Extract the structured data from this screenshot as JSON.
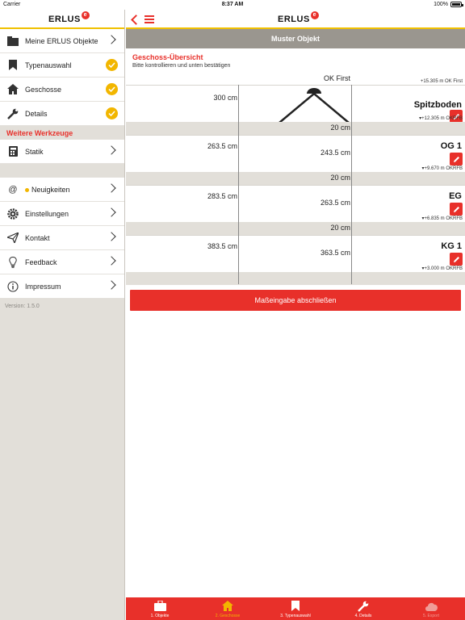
{
  "status_bar": {
    "carrier": "Carrier",
    "time": "8:37 AM",
    "battery": "100%"
  },
  "brand": {
    "name": "ERLUS",
    "badge": "e",
    "accent": "#e8302a",
    "highlight": "#f0c000"
  },
  "sidebar": {
    "items": [
      {
        "label": "Meine ERLUS Objekte",
        "icon": "folder-icon"
      },
      {
        "label": "Typenauswahl",
        "icon": "bookmark-icon",
        "status": "done"
      },
      {
        "label": "Geschosse",
        "icon": "house-icon",
        "status": "done"
      },
      {
        "label": "Details",
        "icon": "wrench-icon",
        "status": "done"
      }
    ],
    "tools_heading": "Weitere Werkzeuge",
    "tools": [
      {
        "label": "Statik",
        "icon": "calculator-icon"
      }
    ],
    "more": [
      {
        "label": "Neuigkeiten",
        "icon": "at-icon"
      },
      {
        "label": "Einstellungen",
        "icon": "gear-icon"
      },
      {
        "label": "Kontakt",
        "icon": "send-icon"
      },
      {
        "label": "Feedback",
        "icon": "bulb-icon"
      },
      {
        "label": "Impressum",
        "icon": "info-icon"
      }
    ],
    "version": "Version: 1.5.0"
  },
  "main": {
    "title": "Muster Objekt",
    "overview_title": "Geschoss-Übersicht",
    "overview_subtitle": "Bitte kontrollieren und unten bestätigen",
    "ok_first_label": "OK First",
    "ok_first_value": "+15.305 m OK First",
    "floors": [
      {
        "name": "Spitzboden",
        "height": "300 cm",
        "inner": "",
        "okrfb": "▾+12.305 m OKRFB",
        "slab": "20 cm"
      },
      {
        "name": "OG 1",
        "height": "263.5 cm",
        "inner": "243.5 cm",
        "okrfb": "▾+9.670 m OKRFB",
        "slab": "20 cm"
      },
      {
        "name": "EG",
        "height": "283.5 cm",
        "inner": "263.5 cm",
        "okrfb": "▾+6.835 m OKRFB",
        "slab": "20 cm"
      },
      {
        "name": "KG 1",
        "height": "383.5 cm",
        "inner": "363.5 cm",
        "okrfb": "▾+3.000 m OKRFB",
        "slab": ""
      }
    ],
    "finish_button": "Maßeingabe abschließen"
  },
  "tabs": [
    {
      "label": "1. Objekte",
      "icon": "briefcase-icon",
      "state": "normal"
    },
    {
      "label": "2. Geschosse",
      "icon": "house-icon",
      "state": "active"
    },
    {
      "label": "3. Typenauswahl",
      "icon": "bookmark-icon",
      "state": "normal"
    },
    {
      "label": "4. Details",
      "icon": "wrench-icon",
      "state": "normal"
    },
    {
      "label": "5. Export",
      "icon": "cloud-icon",
      "state": "disabled"
    }
  ]
}
